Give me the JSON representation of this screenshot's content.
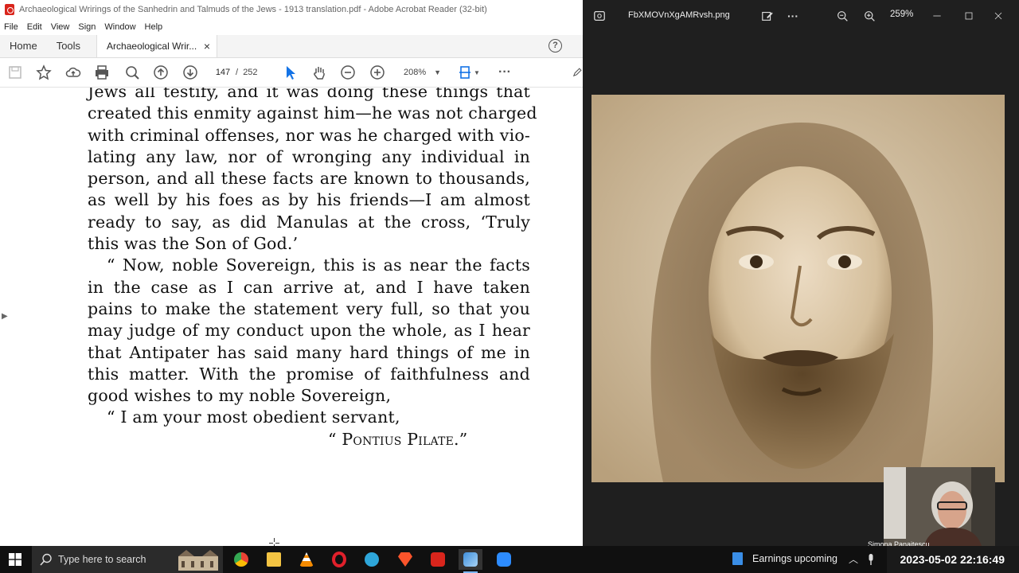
{
  "acrobat": {
    "window_title": "Archaeological Wrirings of the Sanhedrin and Talmuds of the Jews - 1913 translation.pdf - Adobe Acrobat Reader (32-bit)",
    "menu": [
      "File",
      "Edit",
      "View",
      "Sign",
      "Window",
      "Help"
    ],
    "tabs": {
      "home": "Home",
      "tools": "Tools",
      "document": "Archaeological Wrir...",
      "close": "×"
    },
    "toolbar": {
      "page_current": "147",
      "page_separator": "/",
      "page_total": "252",
      "zoom": "208%"
    },
    "page_lines": [
      "Jews all testify, and it was doing these things that",
      "created this enmity against him—he was not charged",
      "with criminal offenses, nor was he charged with vio-",
      "lating any law, nor of wronging any individual in",
      "person, and all these facts are known to thousands,",
      "as well by his foes as by his friends—I am almost",
      "ready to say, as did Manulas at the cross, ‘Truly",
      "this was the Son of God.’",
      "“ Now, noble Sovereign, this is as near the facts",
      "in the case as I can arrive at, and I have taken",
      "pains to make the statement very full, so that you",
      "may judge of my conduct upon the whole, as I hear",
      "that Antipater has said many hard things of me in",
      "this matter. With the promise of faithfulness and",
      "good wishes to my noble Sovereign,",
      "“ I am your most obedient servant,",
      "“ Pontius Pilate.”"
    ]
  },
  "photos": {
    "file_name": "FbXMOVnXgAMRvsh.png",
    "zoom": "259%",
    "more": "···"
  },
  "webcam": {
    "name": "Simona Panaitescu"
  },
  "taskbar": {
    "search_placeholder": "Type here to search",
    "news": "Earnings upcoming",
    "clock": "2023-05-02  22:16:49"
  }
}
